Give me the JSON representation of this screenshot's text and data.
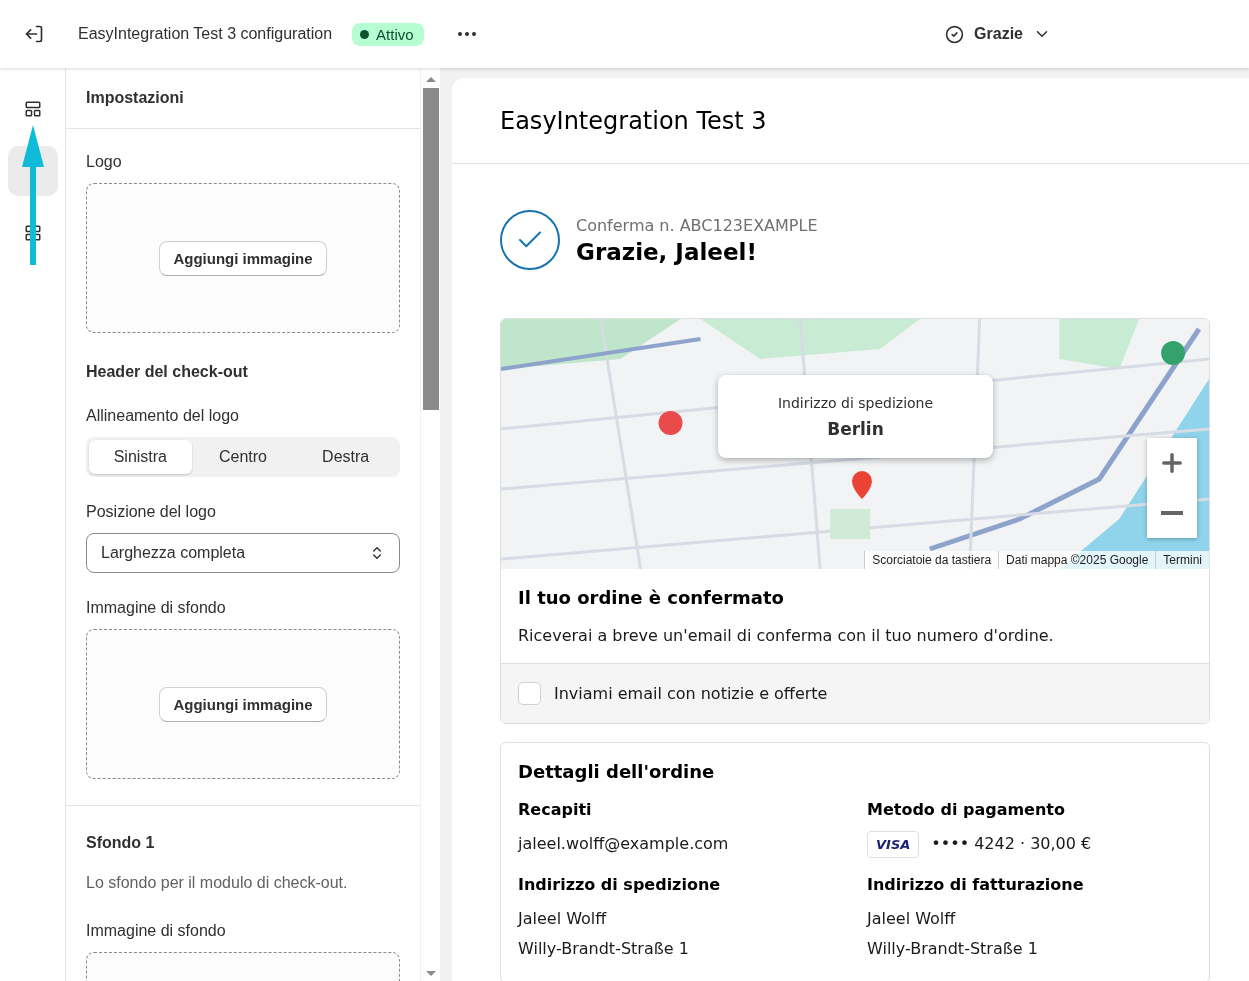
{
  "top_bar": {
    "title": "EasyIntegration Test 3 configuration",
    "status": {
      "label": "Attivo",
      "active": true
    },
    "page_selector": "Grazie"
  },
  "rail": {
    "items": [
      {
        "kind": "sections",
        "selected": false
      },
      {
        "kind": "blank",
        "selected": true
      },
      {
        "kind": "apps",
        "selected": false
      }
    ]
  },
  "settings": {
    "title": "Impostazioni",
    "blocks": [
      {
        "kind": "upload",
        "label": "Logo",
        "button": "Aggiungi immagine"
      },
      {
        "kind": "heading",
        "text": "Header del check-out"
      },
      {
        "kind": "segmented",
        "label": "Allineamento del logo",
        "options": [
          {
            "label": "Sinistra",
            "selected": true
          },
          {
            "label": "Centro",
            "selected": false
          },
          {
            "label": "Destra",
            "selected": false
          }
        ]
      },
      {
        "kind": "select",
        "label": "Posizione del logo",
        "value": "Larghezza completa"
      },
      {
        "kind": "upload",
        "label": "Immagine di sfondo",
        "button": "Aggiungi immagine"
      },
      {
        "kind": "divider"
      },
      {
        "kind": "heading",
        "text": "Sfondo 1"
      },
      {
        "kind": "text",
        "text": "Lo sfondo per il modulo di check-out."
      },
      {
        "kind": "upload",
        "label": "Immagine di sfondo"
      }
    ]
  },
  "preview": {
    "title": "EasyIntegration Test 3",
    "confirmation": {
      "number": "Conferma n. ABC123EXAMPLE",
      "greeting": "Grazie, Jaleel!"
    },
    "map": {
      "popup_label": "Indirizzo di spedizione",
      "popup_value": "Berlin",
      "attribution": [
        "Scorciatoie da tastiera",
        "Dati mappa ©2025 Google",
        "Termini"
      ]
    },
    "status_card": {
      "title": "Il tuo ordine è confermato",
      "message": "Riceverai a breve un'email di conferma con il tuo numero d'ordine.",
      "checkbox": {
        "label": "Inviami email con notizie e offerte",
        "checked": false
      }
    },
    "details": {
      "title": "Dettagli dell'ordine",
      "columns": [
        {
          "sections": [
            {
              "kind": "text",
              "title": "Recapiti",
              "lines": [
                "jaleel.wolff@example.com"
              ]
            },
            {
              "kind": "text",
              "title": "Indirizzo di spedizione",
              "lines": [
                "Jaleel Wolff",
                "Willy-Brandt-Straße 1"
              ]
            }
          ]
        },
        {
          "sections": [
            {
              "kind": "payment",
              "title": "Metodo di pagamento",
              "brand": "VISA",
              "lines": [
                "•••• 4242 · 30,00 €"
              ]
            },
            {
              "kind": "text",
              "title": "Indirizzo di fatturazione",
              "lines": [
                "Jaleel Wolff",
                "Willy-Brandt-Straße 1"
              ]
            }
          ]
        }
      ]
    }
  }
}
